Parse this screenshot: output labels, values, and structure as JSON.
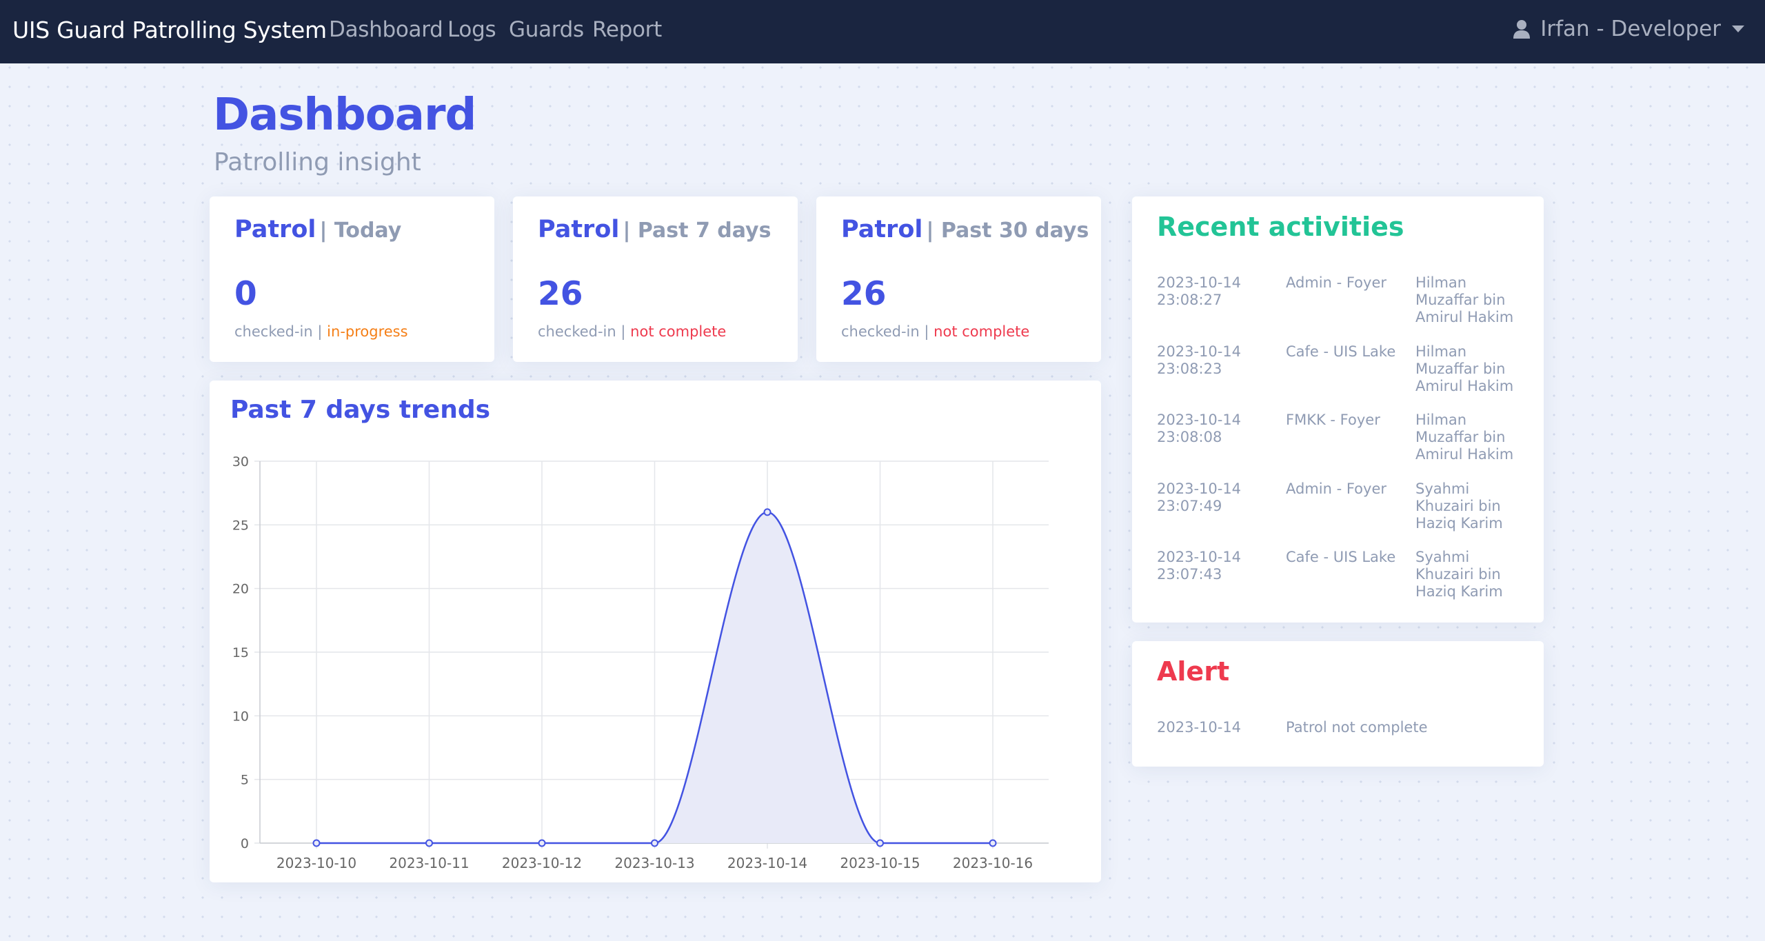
{
  "app": {
    "brand": "UIS Guard Patrolling System",
    "nav": [
      "Dashboard",
      "Logs",
      "Guards",
      "Report"
    ],
    "user": "Irfan - Developer"
  },
  "page": {
    "title": "Dashboard",
    "subtitle": "Patrolling insight"
  },
  "stats": [
    {
      "title": "Patrol",
      "period": "| Today",
      "value": "0",
      "label": "checked-in",
      "sep": "|",
      "status": "in-progress",
      "status_color": "#f57f17"
    },
    {
      "title": "Patrol",
      "period": "| Past 7 days",
      "value": "26",
      "label": "checked-in",
      "sep": "|",
      "status": "not complete",
      "status_color": "#ee3a4e"
    },
    {
      "title": "Patrol",
      "period": "| Past 30 days",
      "value": "26",
      "label": "checked-in",
      "sep": "|",
      "status": "not complete",
      "status_color": "#ee3a4e"
    }
  ],
  "trends": {
    "title": "Past 7 days trends"
  },
  "chart_data": {
    "type": "area",
    "title": "Past 7 days trends",
    "x": [
      "2023-10-10",
      "2023-10-11",
      "2023-10-12",
      "2023-10-13",
      "2023-10-14",
      "2023-10-15",
      "2023-10-16"
    ],
    "series": [
      {
        "values": [
          0,
          0,
          0,
          0,
          26,
          0,
          0
        ]
      }
    ],
    "ylim": [
      0,
      30
    ],
    "yticks": [
      0,
      5,
      10,
      15,
      20,
      25,
      30
    ],
    "grid": true,
    "legend": "none",
    "line_color": "#4353e2",
    "fill_color": "#e8eaf8"
  },
  "recent": {
    "title": "Recent activities",
    "items": [
      {
        "time": "2023-10-14 23:08:27",
        "location": "Admin - Foyer",
        "guard": "Hilman Muzaffar bin Amirul Hakim"
      },
      {
        "time": "2023-10-14 23:08:23",
        "location": "Cafe - UIS Lake",
        "guard": "Hilman Muzaffar bin Amirul Hakim"
      },
      {
        "time": "2023-10-14 23:08:08",
        "location": "FMKK - Foyer",
        "guard": "Hilman Muzaffar bin Amirul Hakim"
      },
      {
        "time": "2023-10-14 23:07:49",
        "location": "Admin - Foyer",
        "guard": "Syahmi Khuzairi bin Haziq Karim"
      },
      {
        "time": "2023-10-14 23:07:43",
        "location": "Cafe - UIS Lake",
        "guard": "Syahmi Khuzairi bin Haziq Karim"
      }
    ]
  },
  "alert": {
    "title": "Alert",
    "items": [
      {
        "date": "2023-10-14",
        "message": "Patrol not complete"
      }
    ]
  },
  "colors": {
    "navbar": "#1a2540",
    "primary": "#4353e2",
    "muted": "#8f9bb3",
    "success": "#22c496",
    "danger": "#ee3a4e",
    "warning": "#f57f17"
  }
}
